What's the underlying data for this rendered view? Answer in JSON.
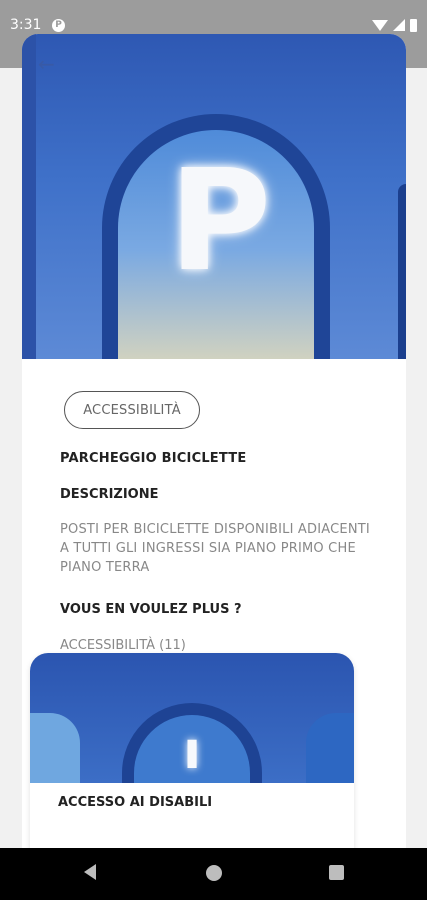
{
  "status_bar": {
    "time": "3:31",
    "app_icon": "P",
    "icons": [
      "wifi-icon",
      "signal-icon",
      "battery-icon"
    ]
  },
  "hero": {
    "image_text": "P",
    "back_icon": "arrow-left-icon"
  },
  "detail": {
    "category_chip": "ACCESSIBILITÀ",
    "title": "PARCHEGGIO BICICLETTE",
    "description_label": "DESCRIZIONE",
    "description_text": "POSTI PER BICICLETTE DISPONIBILI ADIACENTI A TUTTI GLI INGRESSI SIA PIANO PRIMO CHE PIANO TERRA",
    "more_label": "VOUS EN VOULEZ PLUS ?",
    "more_link": "ACCESSIBILITÀ (11)"
  },
  "related_card": {
    "title": "ACCESSO AI DISABILI",
    "icon": "info-icon"
  },
  "colors": {
    "accent_blue": "#2e58b3",
    "text_dark": "#222222",
    "text_muted": "#888888"
  }
}
